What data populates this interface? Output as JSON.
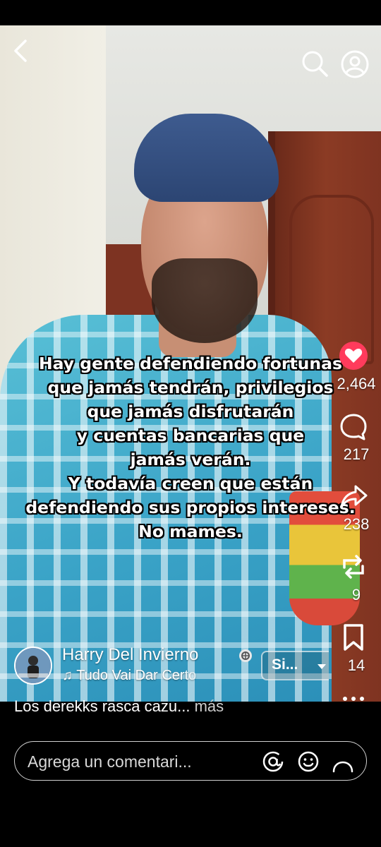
{
  "overlay": {
    "lines": [
      "Hay gente defendiendo fortunas",
      "que jamás tendrán, privilegios",
      "que jamás disfrutarán",
      "y cuentas bancarias que",
      "jamás verán.",
      "Y todavía creen que están",
      "defendiendo sus propios intereses.",
      "No mames."
    ]
  },
  "actions": {
    "likes": "2,464",
    "comments": "217",
    "shares": "238",
    "remixes": "9",
    "saves": "14"
  },
  "author": {
    "name": "Harry Del Invierno",
    "music": "Tudo Vai Dar Certo"
  },
  "follow": {
    "label": "Si..."
  },
  "caption": {
    "text": "Los derekks rasca cazu... ",
    "more": "más"
  },
  "comment": {
    "placeholder": "Agrega un comentari..."
  },
  "icons": {
    "back": "chevron-left-icon",
    "search": "search-icon",
    "profile": "profile-icon",
    "like": "heart-icon",
    "comment": "comment-icon",
    "share": "share-icon",
    "remix": "repost-icon",
    "save": "bookmark-icon",
    "verified": "verified-badge-icon",
    "music": "music-note-icon",
    "mention": "at-icon",
    "emoji": "emoji-icon"
  },
  "colors": {
    "like": "#ff3b5c",
    "background": "#000000"
  }
}
